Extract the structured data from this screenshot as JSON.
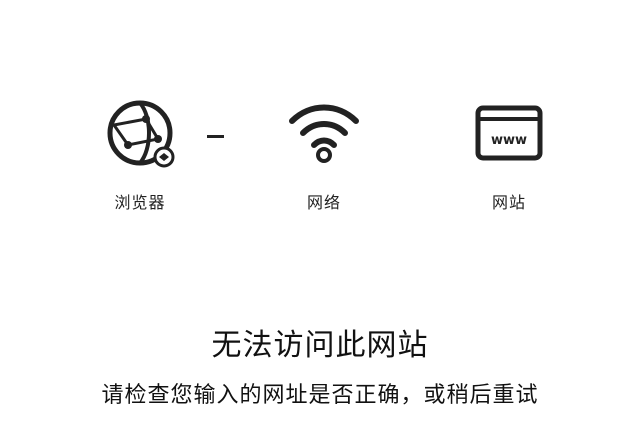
{
  "nodes": {
    "browser": {
      "label": "浏览器",
      "icon": "browser-globe-icon"
    },
    "network": {
      "label": "网络",
      "icon": "wifi-icon"
    },
    "website": {
      "label": "网站",
      "icon": "website-www-icon"
    }
  },
  "error": {
    "title": "无法访问此网站",
    "message": "请检查您输入的网址是否正确，或稍后重试"
  },
  "colors": {
    "icon_stroke": "#222222",
    "text": "#111111",
    "background": "#ffffff"
  }
}
